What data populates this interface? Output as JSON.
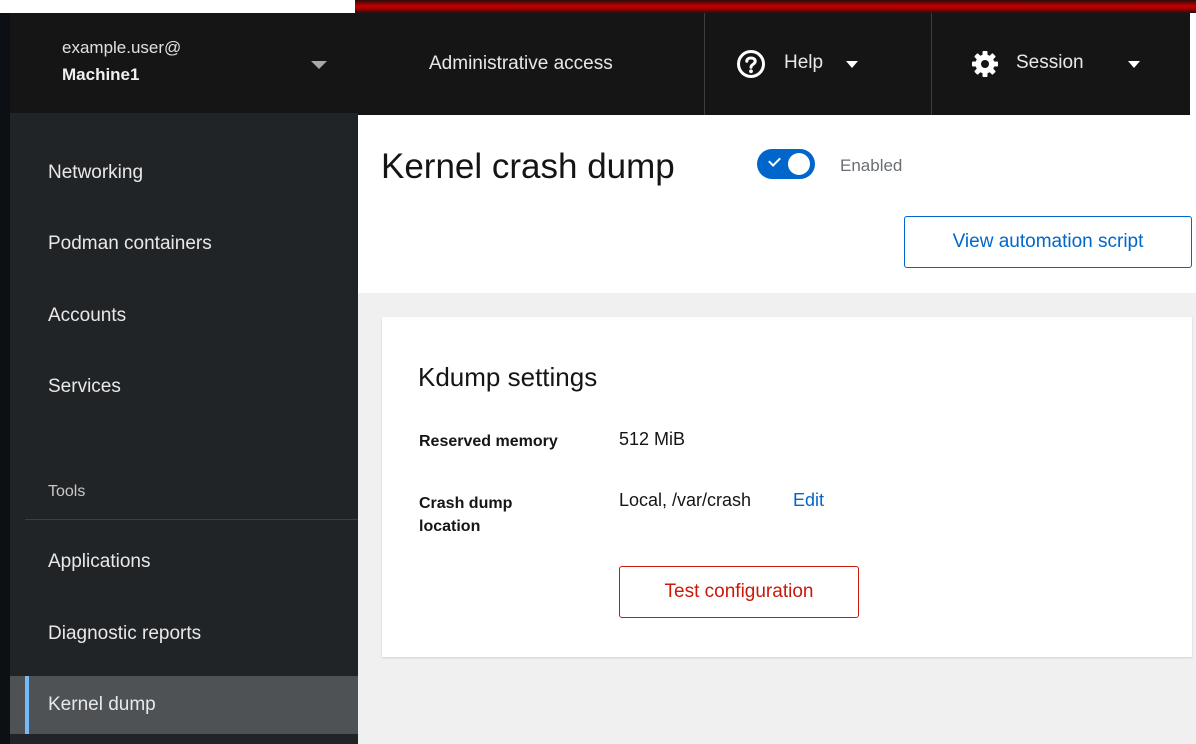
{
  "host": {
    "user": "example.user@",
    "machine": "Machine1"
  },
  "sidebar": {
    "items": [
      {
        "label": "Networking"
      },
      {
        "label": "Podman containers"
      },
      {
        "label": "Accounts"
      },
      {
        "label": "Services"
      }
    ],
    "section_heading": "Tools",
    "tool_items": [
      {
        "label": "Applications"
      },
      {
        "label": "Diagnostic reports"
      },
      {
        "label": "Kernel dump",
        "active": true
      }
    ]
  },
  "masthead": {
    "admin_label": "Administrative access",
    "help_label": "Help",
    "session_label": "Session",
    "icons": [
      "question-circle-icon",
      "gear-icon",
      "caret-down-icon"
    ]
  },
  "page": {
    "title": "Kernel crash dump",
    "toggle_state": "Enabled",
    "toggle_on": true,
    "view_script_label": "View automation script"
  },
  "card": {
    "title": "Kdump settings",
    "reserved_memory_label": "Reserved memory",
    "reserved_memory_value": "512 MiB",
    "location_label_line1": "Crash dump",
    "location_label_line2": "location",
    "location_value": "Local, /var/crash",
    "edit_label": "Edit",
    "test_button_label": "Test configuration"
  },
  "colors": {
    "accent": "#0066cc",
    "danger": "#c9190b",
    "sidebar_bg": "#212427",
    "masthead_bg": "#151515",
    "active_indicator": "#73bcf7"
  }
}
